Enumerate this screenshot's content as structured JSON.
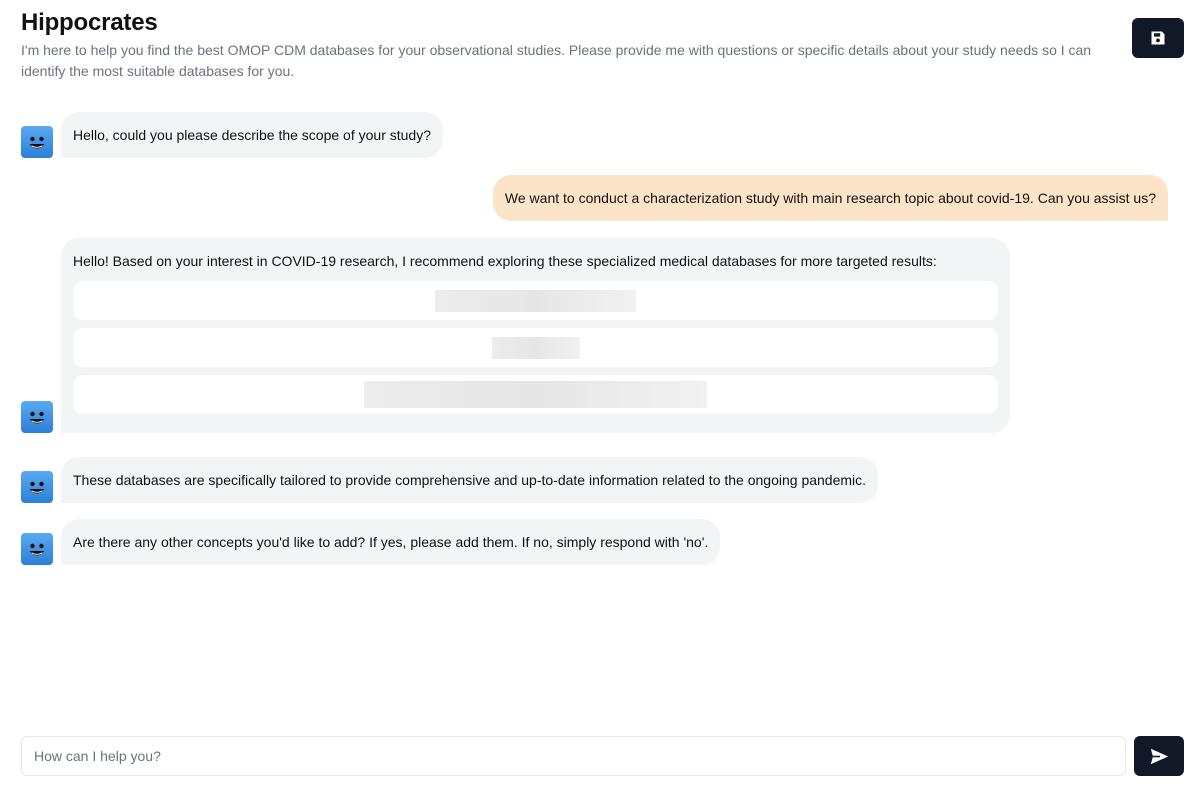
{
  "header": {
    "title": "Hippocrates",
    "subtitle": "I'm here to help you find the best OMOP CDM databases for your observational studies. Please provide me with questions or specific details about your study needs so I can identify the most suitable databases for you.",
    "save_icon": "floppy-disk-icon"
  },
  "colors": {
    "primary_button": "#111827",
    "assistant_bubble": "#f3f4f6",
    "user_bubble": "#fce4c8",
    "avatar": "#2c7fd7"
  },
  "messages": [
    {
      "role": "assistant",
      "text": "Hello, could you please describe the scope of your study?"
    },
    {
      "role": "user",
      "text": "We want to conduct a characterization study with main research topic about covid-19. Can you assist us?"
    },
    {
      "role": "assistant",
      "text": "Hello! Based on your interest in COVID-19 research, I recommend exploring these specialized medical databases for more targeted results:"
    },
    {
      "role": "assistant",
      "text": "These databases are specifically tailored to provide comprehensive and up-to-date information related to the ongoing pandemic."
    },
    {
      "role": "assistant",
      "text": "Are there any other concepts you'd like to add? If yes, please add them. If no, simply respond with 'no'."
    }
  ],
  "database_options_count": 3,
  "input": {
    "placeholder": "How can I help you?",
    "value": ""
  },
  "send_icon": "paper-plane-icon"
}
